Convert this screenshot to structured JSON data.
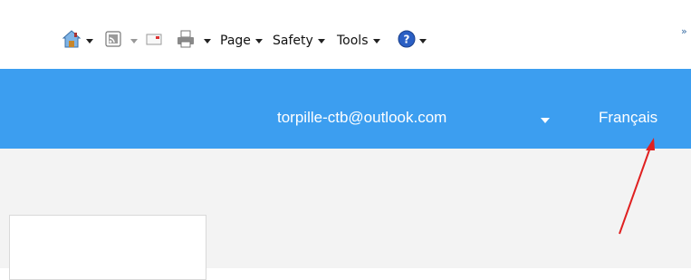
{
  "command_bar": {
    "page_label": "Page",
    "safety_label": "Safety",
    "tools_label": "Tools",
    "overflow_glyph": "»",
    "icons": [
      "home-icon",
      "feeds-icon",
      "read-mail-icon",
      "print-icon",
      "help-icon"
    ]
  },
  "header": {
    "account": "torpille-ctb@outlook.com",
    "language": "Français",
    "background_color": "#3c9ef0"
  },
  "annotation": {
    "arrow_color": "#e02020"
  }
}
